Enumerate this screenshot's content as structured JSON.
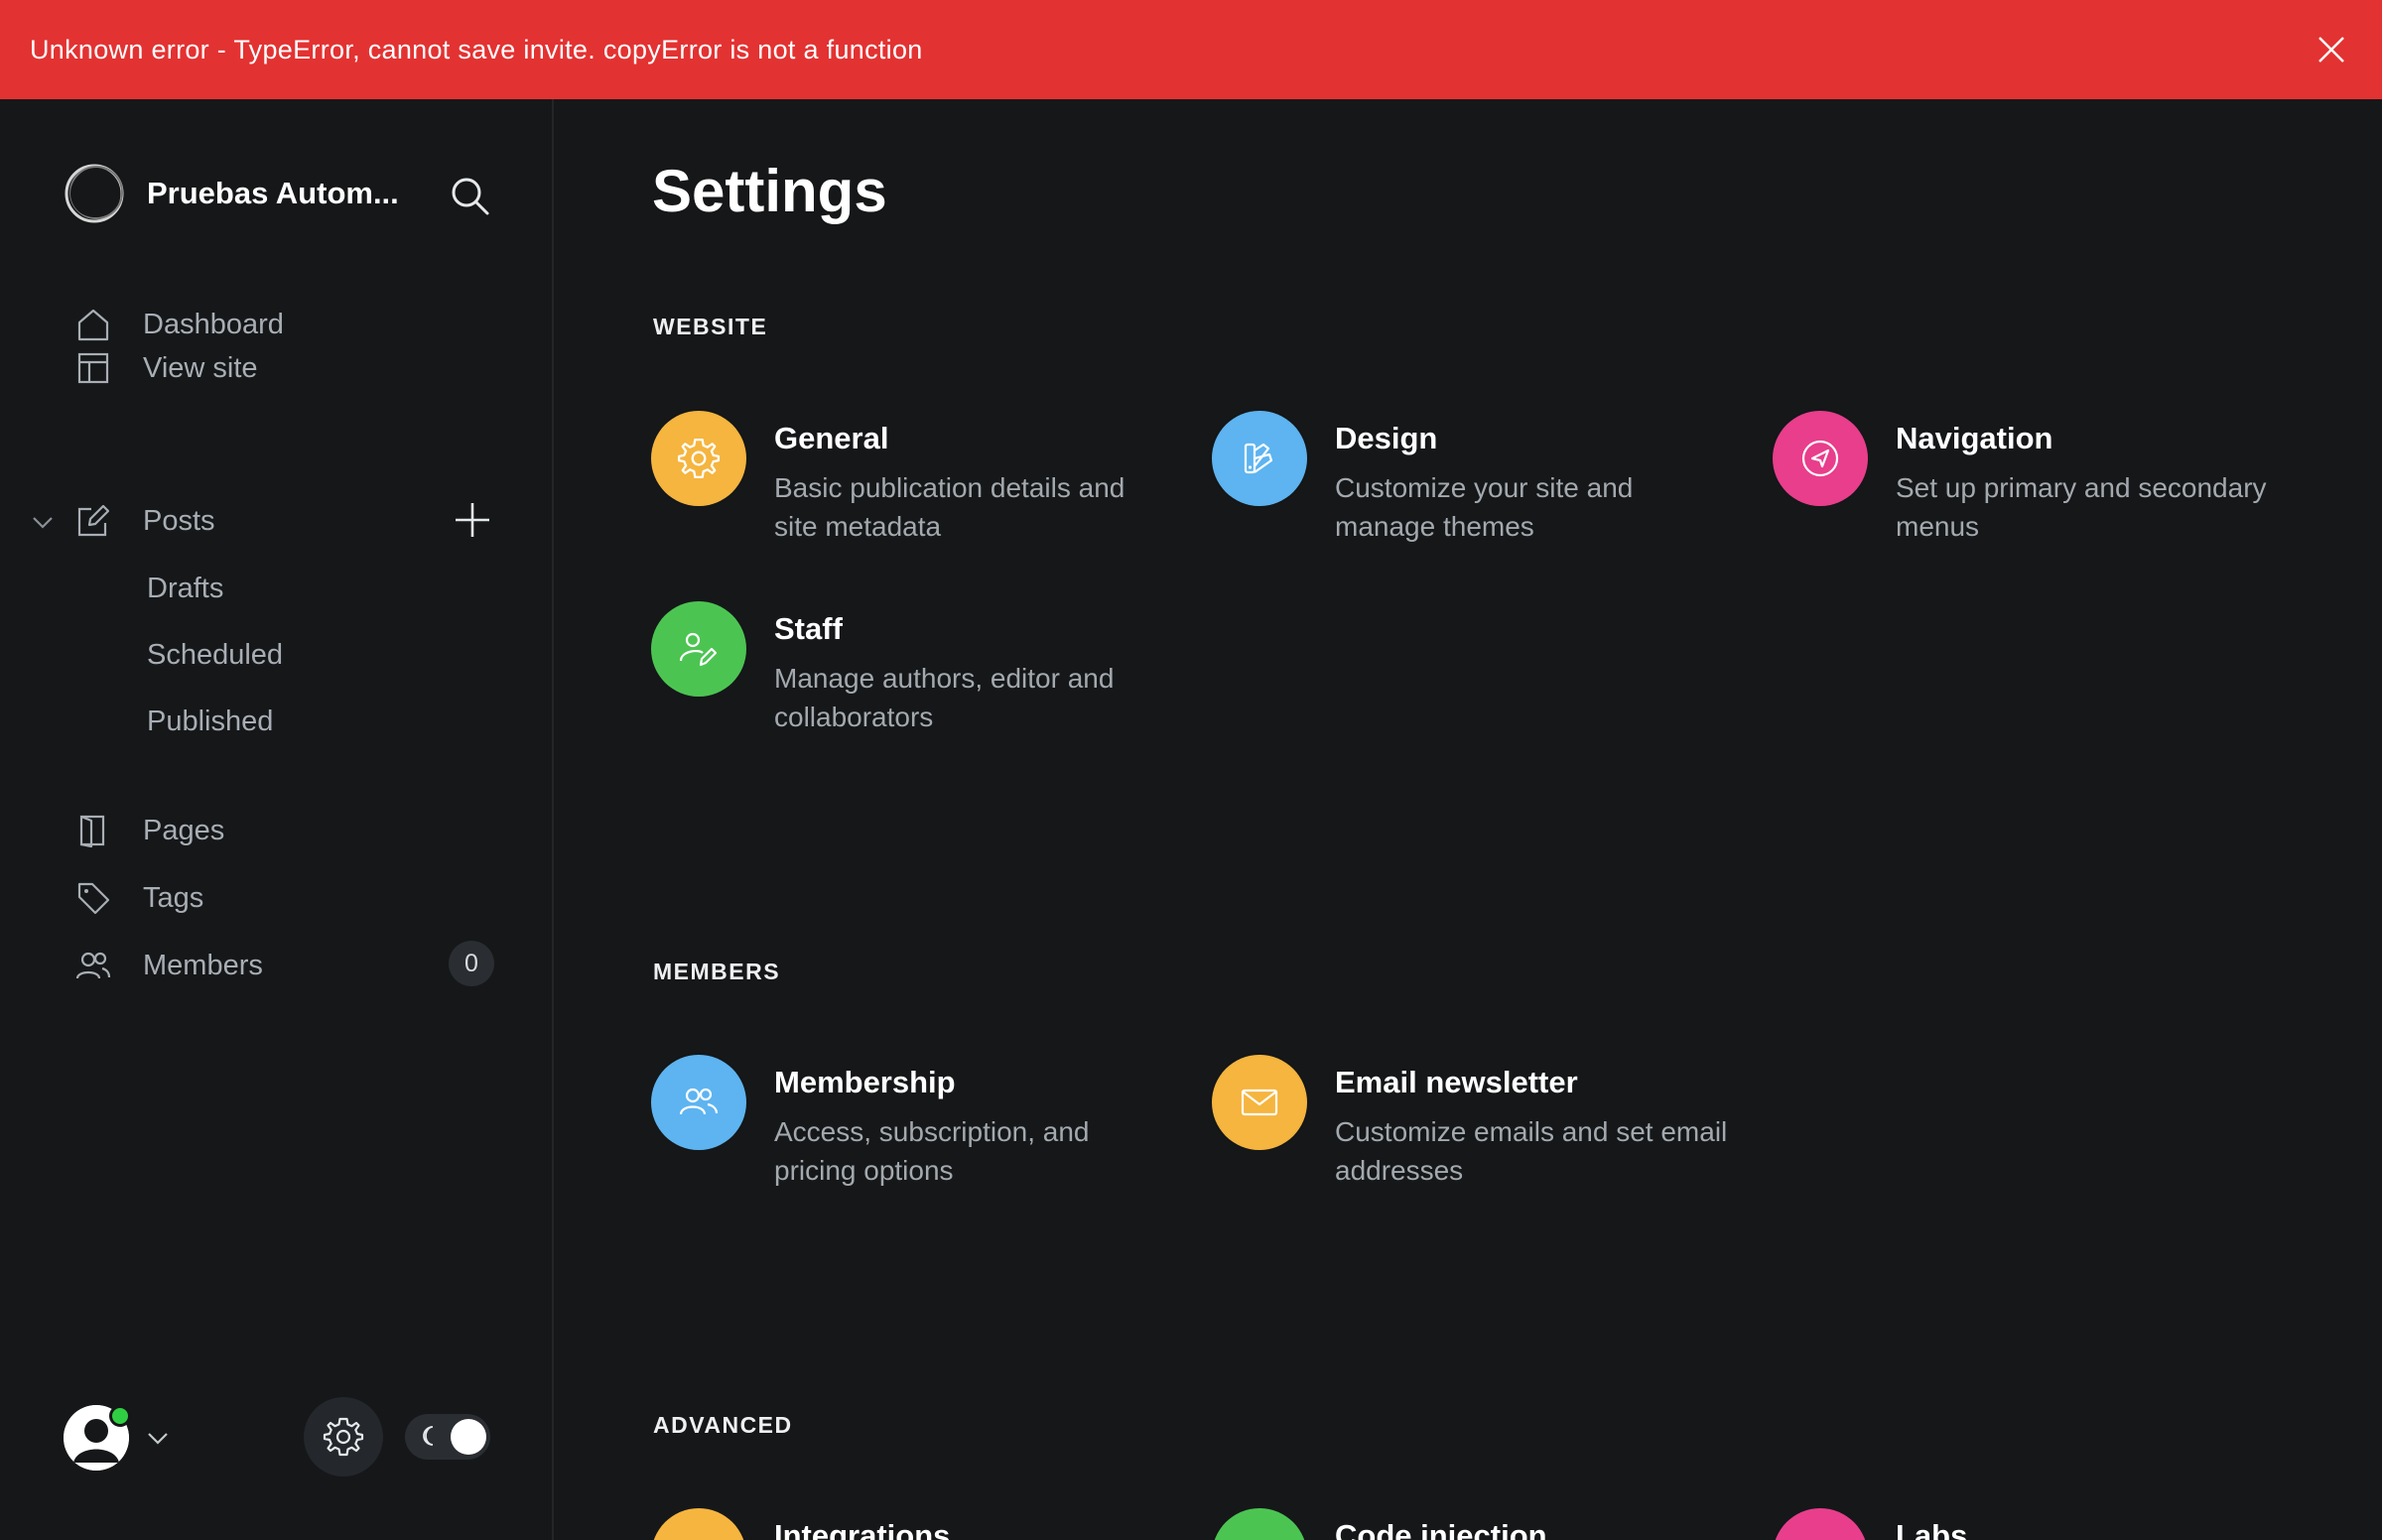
{
  "banner": {
    "message": "Unknown error - TypeError, cannot save invite. copyError is not a function",
    "color": "#e33232"
  },
  "sidebar": {
    "site_name": "Pruebas Autom...",
    "nav": {
      "dashboard": "Dashboard",
      "view_site": "View site",
      "posts": "Posts",
      "drafts": "Drafts",
      "scheduled": "Scheduled",
      "published": "Published",
      "pages": "Pages",
      "tags": "Tags",
      "members": "Members",
      "members_count": "0"
    }
  },
  "main": {
    "title": "Settings",
    "sections": {
      "website": {
        "label": "WEBSITE",
        "cards": [
          {
            "title": "General",
            "desc": "Basic publication details and site metadata",
            "icon": "gear-icon",
            "color": "#f5b53f"
          },
          {
            "title": "Design",
            "desc": "Customize your site and manage themes",
            "icon": "palette-icon",
            "color": "#5eb4f0"
          },
          {
            "title": "Navigation",
            "desc": "Set up primary and secondary menus",
            "icon": "compass-icon",
            "color": "#e83e8c"
          },
          {
            "title": "Staff",
            "desc": "Manage authors, editor and collaborators",
            "icon": "user-edit-icon",
            "color": "#4cc452"
          }
        ]
      },
      "members": {
        "label": "MEMBERS",
        "cards": [
          {
            "title": "Membership",
            "desc": "Access, subscription, and pricing options",
            "icon": "users-icon",
            "color": "#5eb4f0"
          },
          {
            "title": "Email newsletter",
            "desc": "Customize emails and set email addresses",
            "icon": "envelope-icon",
            "color": "#f5b53f"
          }
        ]
      },
      "advanced": {
        "label": "ADVANCED",
        "cards": [
          {
            "title": "Integrations",
            "icon": "integrations-icon",
            "color": "#f5b53f"
          },
          {
            "title": "Code injection",
            "icon": "code-icon",
            "color": "#4cc452"
          },
          {
            "title": "Labs",
            "icon": "labs-icon",
            "color": "#e83e8c"
          }
        ]
      }
    }
  }
}
